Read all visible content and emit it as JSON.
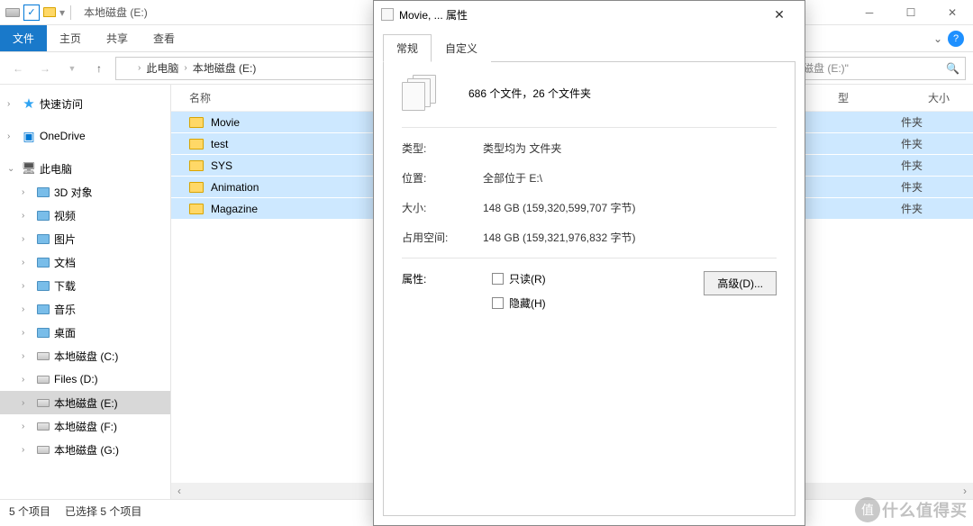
{
  "window": {
    "title": "本地磁盘 (E:)"
  },
  "ribbon": {
    "file": "文件",
    "home": "主页",
    "share": "共享",
    "view": "查看"
  },
  "breadcrumb": {
    "pc": "此电脑",
    "drive": "本地磁盘 (E:)"
  },
  "search": {
    "placeholder": "地磁盘 (E:)\""
  },
  "nav": {
    "quick_access": "快速访问",
    "onedrive": "OneDrive",
    "this_pc": "此电脑",
    "items": {
      "3d": "3D 对象",
      "video": "视频",
      "pictures": "图片",
      "documents": "文档",
      "downloads": "下载",
      "music": "音乐",
      "desktop": "桌面",
      "drive_c": "本地磁盘 (C:)",
      "drive_d": "Files (D:)",
      "drive_e": "本地磁盘 (E:)",
      "drive_f": "本地磁盘 (F:)",
      "drive_g": "本地磁盘 (G:)"
    }
  },
  "columns": {
    "name": "名称",
    "type_hdr": "型",
    "size": "大小"
  },
  "files": [
    {
      "name": "Movie",
      "type": "件夹"
    },
    {
      "name": "test",
      "type": "件夹"
    },
    {
      "name": "SYS",
      "type": "件夹"
    },
    {
      "name": "Animation",
      "type": "件夹"
    },
    {
      "name": "Magazine",
      "type": "件夹"
    }
  ],
  "status": {
    "count": "5 个项目",
    "selected": "已选择 5 个项目"
  },
  "dialog": {
    "title": "Movie, ... 属性",
    "tabs": {
      "general": "常规",
      "custom": "自定义"
    },
    "summary": "686 个文件，26 个文件夹",
    "labels": {
      "type": "类型:",
      "location": "位置:",
      "size": "大小:",
      "size_on_disk": "占用空间:",
      "attributes": "属性:"
    },
    "values": {
      "type": "类型均为 文件夹",
      "location": "全部位于 E:\\",
      "size": "148 GB (159,320,599,707 字节)",
      "size_on_disk": "148 GB (159,321,976,832 字节)"
    },
    "checks": {
      "readonly": "只读(R)",
      "hidden": "隐藏(H)"
    },
    "advanced": "高级(D)..."
  },
  "watermark": {
    "badge": "值",
    "text": "什么值得买"
  }
}
